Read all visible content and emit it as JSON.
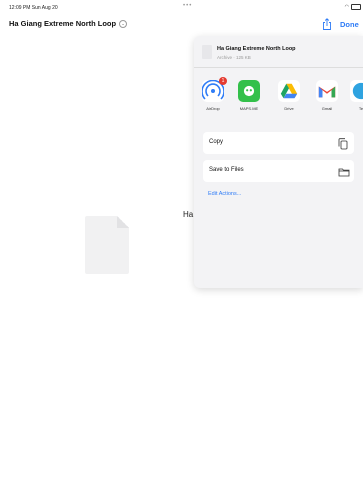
{
  "status": {
    "time": "12:09 PM  Sun Aug 20",
    "dots": "•••"
  },
  "nav": {
    "title": "Ha Giang Extreme North Loop",
    "done": "Done"
  },
  "background": {
    "title": "Ha"
  },
  "sheet": {
    "file_name": "Ha Giang Extreme North Loop",
    "file_meta": "Archive · 125 KB",
    "apps": [
      {
        "label": "AirDrop",
        "icon": "airdrop-icon",
        "badge": "1"
      },
      {
        "label": "MAPS.ME",
        "icon": "mapsme-icon"
      },
      {
        "label": "Drive",
        "icon": "google-drive-icon"
      },
      {
        "label": "Gmail",
        "icon": "gmail-icon"
      },
      {
        "label": "Te",
        "icon": "telegram-icon"
      }
    ],
    "actions": [
      {
        "label": "Copy",
        "icon": "copy-icon"
      },
      {
        "label": "Save to Files",
        "icon": "folder-icon"
      }
    ],
    "edit_actions": "Edit Actions..."
  },
  "colors": {
    "accent": "#2f7cf6",
    "badge": "#e53a2f",
    "mapsme": "#33c04a"
  }
}
